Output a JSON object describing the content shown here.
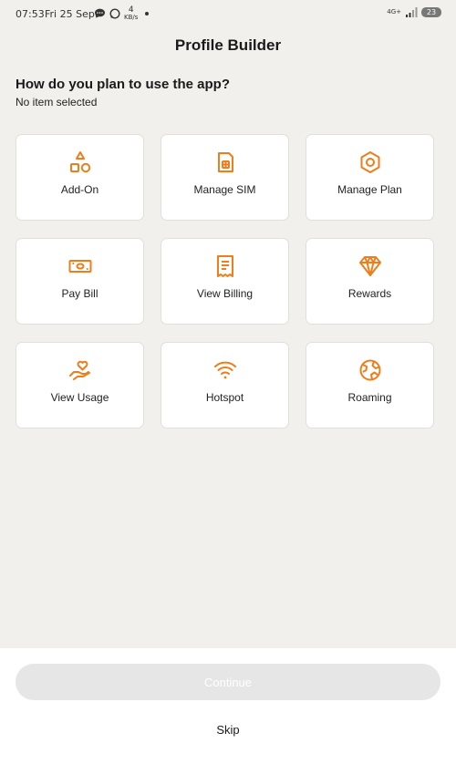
{
  "status_bar": {
    "time": "07:53",
    "date": "Fri 25 Sept",
    "speed_value": "4",
    "speed_unit": "KB/s",
    "network": "4G+",
    "battery": "23"
  },
  "header": {
    "title": "Profile Builder"
  },
  "prompt": {
    "question": "How do you plan to use the app?",
    "selection_status": "No item selected"
  },
  "options": [
    {
      "label": "Add-On",
      "icon": "shapes-icon"
    },
    {
      "label": "Manage SIM",
      "icon": "sim-card-icon"
    },
    {
      "label": "Manage Plan",
      "icon": "hexagon-icon"
    },
    {
      "label": "Pay Bill",
      "icon": "banknote-icon"
    },
    {
      "label": "View Billing",
      "icon": "receipt-icon"
    },
    {
      "label": "Rewards",
      "icon": "diamond-icon"
    },
    {
      "label": "View Usage",
      "icon": "hand-heart-icon"
    },
    {
      "label": "Hotspot",
      "icon": "wifi-icon"
    },
    {
      "label": "Roaming",
      "icon": "globe-icon"
    }
  ],
  "footer": {
    "continue_label": "Continue",
    "skip_label": "Skip"
  },
  "colors": {
    "accent": "#ee7d1a",
    "background": "#f2f0ec",
    "card": "#ffffff",
    "disabled_button": "#e6e6e6"
  }
}
